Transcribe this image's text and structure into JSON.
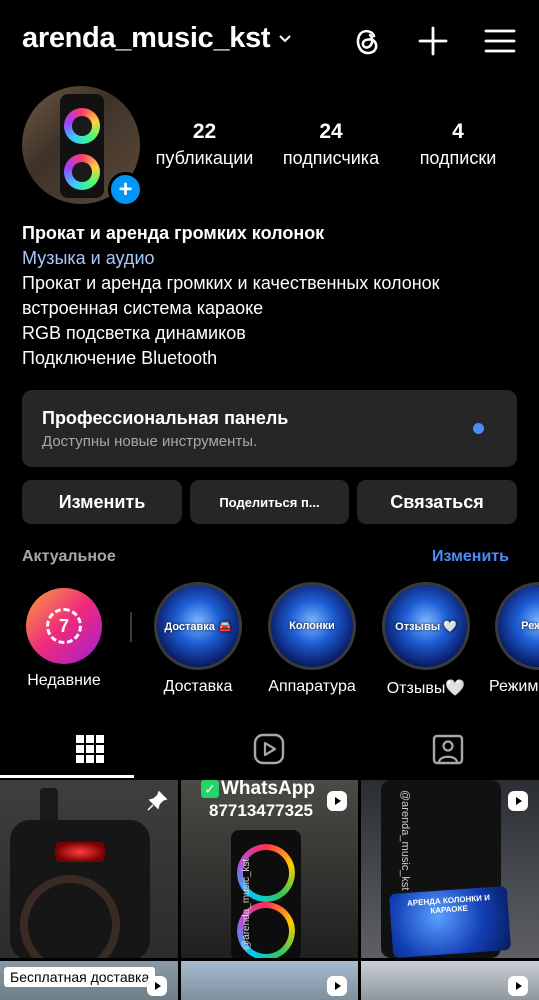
{
  "header": {
    "username": "arenda_music_kst",
    "icons": [
      "chevron-down-icon",
      "threads-icon",
      "plus-icon",
      "menu-icon"
    ]
  },
  "profile": {
    "stats": [
      {
        "value": "22",
        "label": "публикации"
      },
      {
        "value": "24",
        "label": "подписчика"
      },
      {
        "value": "4",
        "label": "подписки"
      }
    ],
    "add_story_symbol": "+"
  },
  "bio": {
    "name": "Прокат и аренда громких колонок",
    "category": "Музыка и аудио",
    "lines": [
      "Прокат и аренда громких и качественных колонок",
      "встроенная система караоке",
      "RGB подсветка динамиков",
      "Подключение Bluetooth"
    ]
  },
  "pro_panel": {
    "title": "Профессиональная панель",
    "subtitle": "Доступны новые инструменты."
  },
  "buttons": {
    "edit": "Изменить",
    "share": "Поделиться п...",
    "contact": "Связаться"
  },
  "highlights": {
    "title": "Актуальное",
    "edit": "Изменить",
    "recent": {
      "label": "Недавние",
      "number": "7"
    },
    "items": [
      {
        "cover_text": "Доставка 🚘",
        "label": "Доставка"
      },
      {
        "cover_text": "Колонки",
        "label": "Аппаратура"
      },
      {
        "cover_text": "Отзывы 🤍",
        "label": "Отзывы🤍"
      },
      {
        "cover_text": "Режим",
        "label": "Режим"
      }
    ]
  },
  "tabs": [
    "grid-icon",
    "reels-icon",
    "tagged-icon"
  ],
  "posts": [
    {
      "overlay": ""
    },
    {
      "whatsapp": "WhatsApp",
      "phone": "87713477325",
      "watermark": "@arenda_music_kst"
    },
    {
      "watermark": "@arenda_music_kst",
      "card": "АРЕНДА КОЛОНКИ И КАРАОКЕ"
    },
    {
      "overlay": "Бесплатная доставка"
    },
    {
      "overlay": ""
    },
    {
      "overlay": ""
    }
  ],
  "colors": {
    "background": "#000000",
    "panel": "#262626",
    "accent": "#4a8df8",
    "category": "#a8c7fa",
    "muted": "#a8a8a8"
  }
}
